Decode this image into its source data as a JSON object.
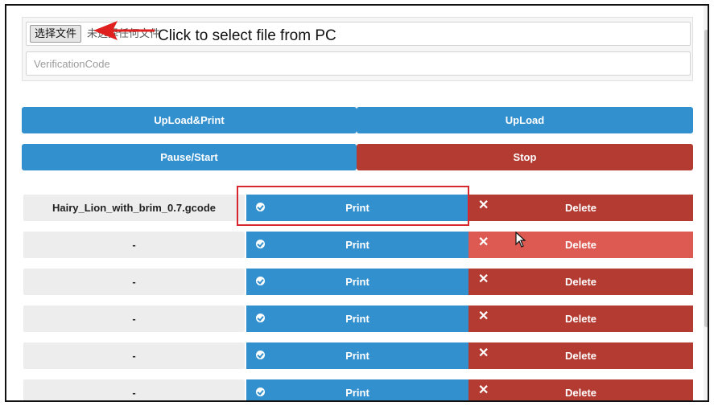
{
  "upload_form": {
    "file_button_label": "选择文件",
    "file_status_text": "未选择任何文件",
    "annotation_text": "Click to select file from PC",
    "verification_placeholder": "VerificationCode"
  },
  "actions": {
    "upload_print_label": "UpLoad&Print",
    "upload_label": "UpLoad",
    "pause_start_label": "Pause/Start",
    "stop_label": "Stop"
  },
  "files": [
    {
      "name": "Hairy_Lion_with_brim_0.7.gcode",
      "print_label": "Print",
      "delete_label": "Delete"
    },
    {
      "name": "-",
      "print_label": "Print",
      "delete_label": "Delete"
    },
    {
      "name": "-",
      "print_label": "Print",
      "delete_label": "Delete"
    },
    {
      "name": "-",
      "print_label": "Print",
      "delete_label": "Delete"
    },
    {
      "name": "-",
      "print_label": "Print",
      "delete_label": "Delete"
    },
    {
      "name": "-",
      "print_label": "Print",
      "delete_label": "Delete"
    }
  ],
  "icons": {
    "print": "check-circle-icon",
    "delete": "close-icon",
    "cursor": "mouse-cursor-icon",
    "annotation": "red-arrow-icon"
  },
  "colors": {
    "primary_blue": "#3390cf",
    "danger_red": "#b43b32",
    "danger_red_hover": "#dc5a51",
    "highlight_outline": "#d7262d",
    "file_cell_bg": "#ededed"
  }
}
